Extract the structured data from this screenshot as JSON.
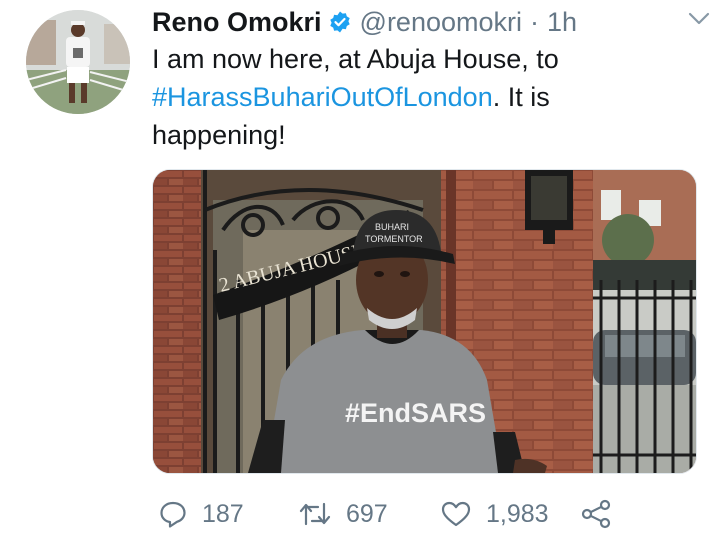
{
  "tweet": {
    "author_name": "Reno Omokri",
    "handle": "@renoomokri",
    "separator": "·",
    "time": "1h",
    "text_line1": "I am now here, at Abuja House, to",
    "hashtag": "#HarassBuhariOutOfLondon",
    "text_after_hashtag": ". It is",
    "text_line3": "happening!"
  },
  "media": {
    "gate_sign": "2 ABUJA HOUSE",
    "cap_line1": "BUHARI",
    "cap_line2": "TORMENTOR",
    "shirt_text": "#EndSARS"
  },
  "actions": {
    "replies": "187",
    "retweets": "697",
    "likes": "1,983"
  },
  "icons": [
    "verified-badge-icon",
    "chevron-down-icon",
    "reply-icon",
    "retweet-icon",
    "like-icon",
    "share-icon"
  ],
  "colors": {
    "link": "#1b95e0",
    "muted": "#657786",
    "text": "#14171a",
    "verified": "#1da1f2"
  }
}
